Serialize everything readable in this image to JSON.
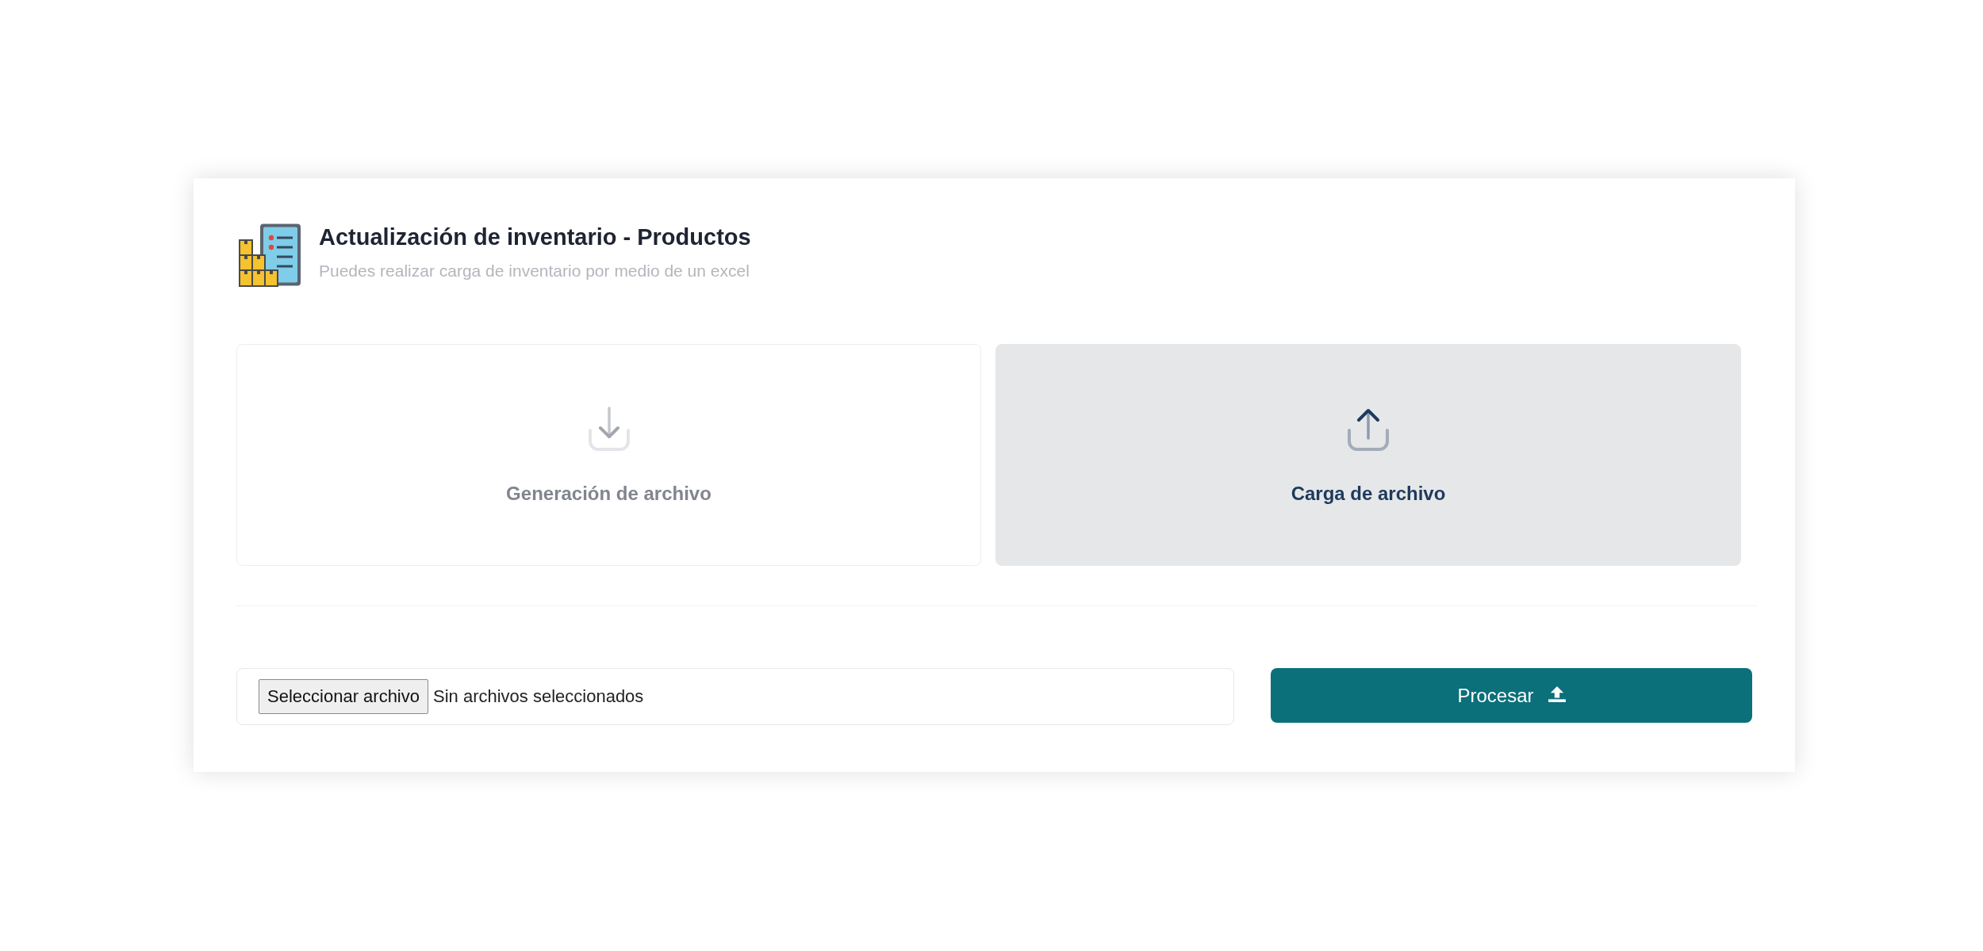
{
  "header": {
    "title": "Actualización de inventario - Productos",
    "subtitle": "Puedes realizar carga de inventario por medio de un excel"
  },
  "options": [
    {
      "kind": "download",
      "label": "Generación de archivo",
      "selected": false
    },
    {
      "kind": "upload",
      "label": "Carga de archivo",
      "selected": true
    }
  ],
  "file_input": {
    "button_label": "Seleccionar archivo",
    "status": "Sin archivos seleccionados"
  },
  "submit_button": {
    "label": "Procesar"
  }
}
